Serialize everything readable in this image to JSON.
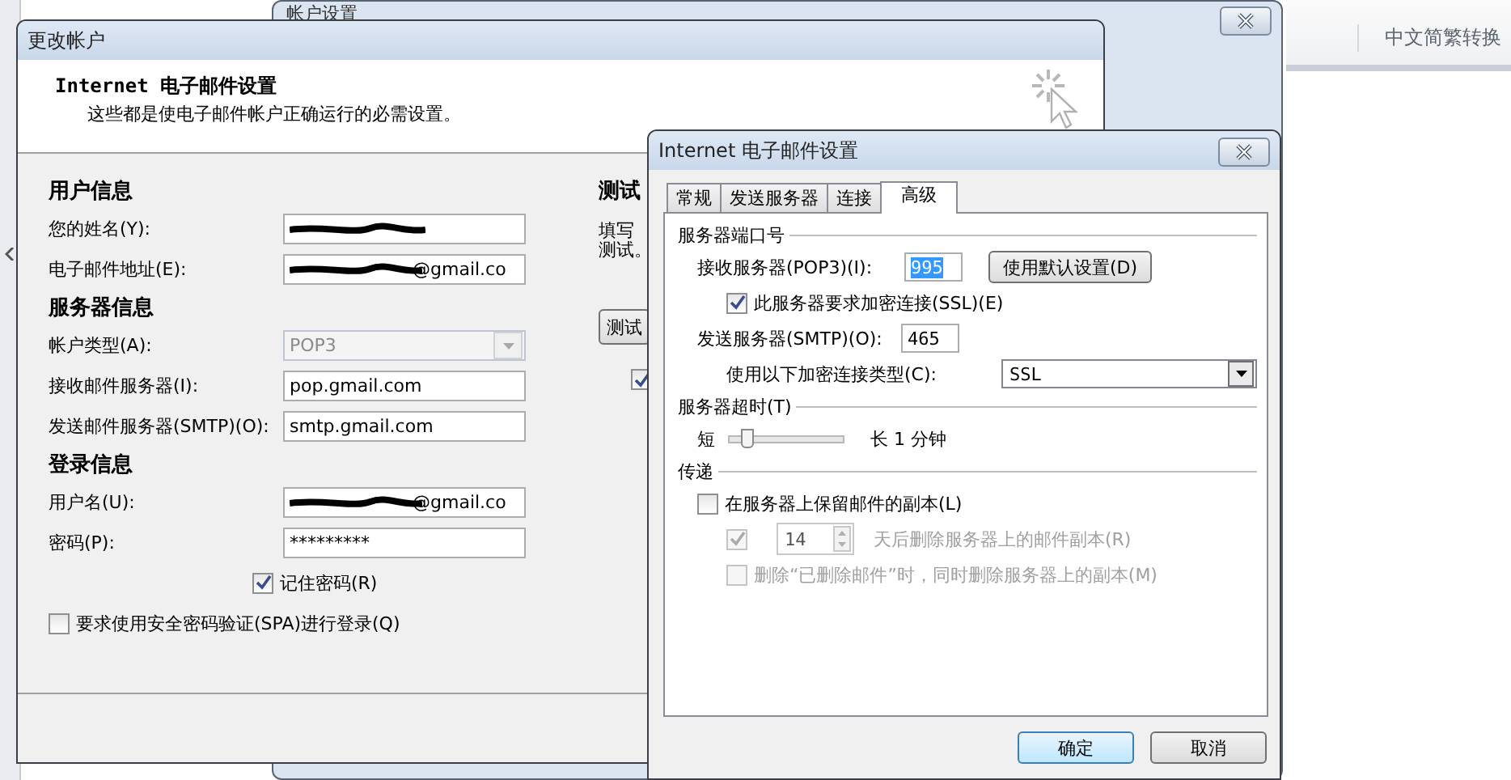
{
  "background": {
    "window_title": "帐户设置",
    "ribbon_label": "中文简繁转换"
  },
  "main_window": {
    "title": "更改帐户",
    "header": {
      "title": "Internet 电子邮件设置",
      "subtitle": "这些都是使电子邮件帐户正确运行的必需设置。"
    },
    "sections": [
      {
        "heading": "用户信息",
        "fields": [
          {
            "label": "您的姓名(Y):",
            "kind": "text",
            "redacted": true
          },
          {
            "label": "电子邮件地址(E):",
            "kind": "text",
            "redacted": true,
            "value": "@gmail.co"
          }
        ]
      },
      {
        "heading": "服务器信息",
        "fields": [
          {
            "label": "帐户类型(A):",
            "kind": "select",
            "disabled": true,
            "value": "POP3"
          },
          {
            "label": "接收邮件服务器(I):",
            "kind": "text",
            "redacted": false,
            "value": "pop.gmail.com"
          },
          {
            "label": "发送邮件服务器(SMTP)(O):",
            "kind": "text",
            "redacted": false,
            "value": "smtp.gmail.com"
          }
        ]
      },
      {
        "heading": "登录信息",
        "fields": [
          {
            "label": "用户名(U):",
            "kind": "text",
            "redacted": true,
            "value": "@gmail.co"
          },
          {
            "label": "密码(P):",
            "kind": "text",
            "redacted": false,
            "value": "*********"
          }
        ]
      }
    ],
    "remember": {
      "label": "记住密码(R)",
      "checked": true
    },
    "spa": {
      "label": "要求使用安全密码验证(SPA)进行登录(Q)",
      "checked": false
    },
    "test_panel": {
      "heading": "测试",
      "lines": [
        "填写",
        "测试。"
      ],
      "button": "测试",
      "checkbox": {
        "checked": true
      }
    }
  },
  "dialog": {
    "title": "Internet 电子邮件设置",
    "tabs": [
      {
        "label": "常规",
        "selected": false
      },
      {
        "label": "发送服务器",
        "selected": false
      },
      {
        "label": "连接",
        "selected": false
      },
      {
        "label": "高级",
        "selected": true
      }
    ],
    "ports": {
      "heading": "服务器端口号",
      "incoming_label": "接收服务器(POP3)(I):",
      "incoming_value": "995",
      "incoming_text_selected": true,
      "default_button": "使用默认设置(D)",
      "ssl": {
        "label": "此服务器要求加密连接(SSL)(E)",
        "checked": true
      },
      "outgoing_label": "发送服务器(SMTP)(O):",
      "outgoing_value": "465",
      "encryption_label": "使用以下加密连接类型(C):",
      "encryption_value": "SSL"
    },
    "timeout": {
      "heading": "服务器超时(T)",
      "short_label": "短",
      "level": 0.1,
      "reading": "长 1 分钟"
    },
    "delivery": {
      "heading": "传递",
      "options": [
        {
          "kind": "checkbox",
          "label": "在服务器上保留邮件的副本(L)",
          "checked": false,
          "disabled": false
        },
        {
          "kind": "days",
          "label": "天后删除服务器上的邮件副本(R)",
          "checked": true,
          "disabled": true,
          "days": "14"
        },
        {
          "kind": "checkbox",
          "label": "删除“已删除邮件”时，同时删除服务器上的副本(M)",
          "checked": false,
          "disabled": true
        }
      ]
    },
    "buttons": [
      {
        "label": "确定",
        "default": true
      },
      {
        "label": "取消",
        "default": false
      }
    ]
  }
}
